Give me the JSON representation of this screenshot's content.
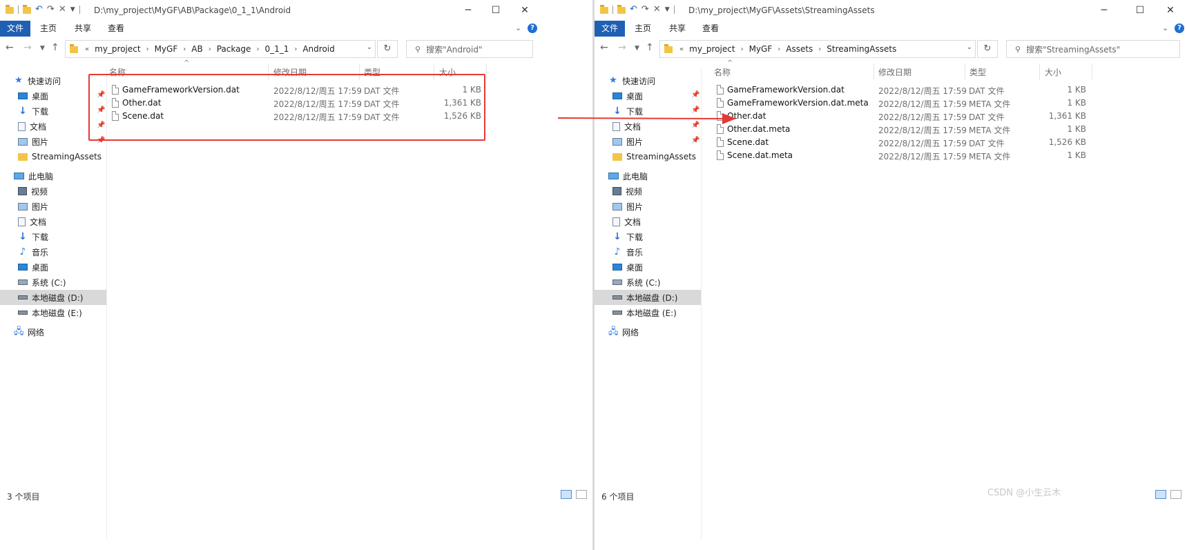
{
  "left": {
    "title_path": "D:\\my_project\\MyGF\\AB\\Package\\0_1_1\\Android",
    "ribbon": {
      "file": "文件",
      "home": "主页",
      "share": "共享",
      "view": "查看"
    },
    "breadcrumb": [
      "my_project",
      "MyGF",
      "AB",
      "Package",
      "0_1_1",
      "Android"
    ],
    "search_placeholder": "搜索\"Android\"",
    "columns": {
      "name": "名称",
      "date": "修改日期",
      "type": "类型",
      "size": "大小"
    },
    "files": [
      {
        "name": "GameFrameworkVersion.dat",
        "date": "2022/8/12/周五 17:59",
        "type": "DAT 文件",
        "size": "1 KB"
      },
      {
        "name": "Other.dat",
        "date": "2022/8/12/周五 17:59",
        "type": "DAT 文件",
        "size": "1,361 KB"
      },
      {
        "name": "Scene.dat",
        "date": "2022/8/12/周五 17:59",
        "type": "DAT 文件",
        "size": "1,526 KB"
      }
    ],
    "status": "3 个项目"
  },
  "right": {
    "title_path": "D:\\my_project\\MyGF\\Assets\\StreamingAssets",
    "ribbon": {
      "file": "文件",
      "home": "主页",
      "share": "共享",
      "view": "查看"
    },
    "breadcrumb": [
      "my_project",
      "MyGF",
      "Assets",
      "StreamingAssets"
    ],
    "search_placeholder": "搜索\"StreamingAssets\"",
    "columns": {
      "name": "名称",
      "date": "修改日期",
      "type": "类型",
      "size": "大小"
    },
    "files": [
      {
        "name": "GameFrameworkVersion.dat",
        "date": "2022/8/12/周五 17:59",
        "type": "DAT 文件",
        "size": "1 KB"
      },
      {
        "name": "GameFrameworkVersion.dat.meta",
        "date": "2022/8/12/周五 17:59",
        "type": "META 文件",
        "size": "1 KB"
      },
      {
        "name": "Other.dat",
        "date": "2022/8/12/周五 17:59",
        "type": "DAT 文件",
        "size": "1,361 KB"
      },
      {
        "name": "Other.dat.meta",
        "date": "2022/8/12/周五 17:59",
        "type": "META 文件",
        "size": "1 KB"
      },
      {
        "name": "Scene.dat",
        "date": "2022/8/12/周五 17:59",
        "type": "DAT 文件",
        "size": "1,526 KB"
      },
      {
        "name": "Scene.dat.meta",
        "date": "2022/8/12/周五 17:59",
        "type": "META 文件",
        "size": "1 KB"
      }
    ],
    "status": "6 个项目"
  },
  "nav": {
    "quick_access": "快速访问",
    "desktop": "桌面",
    "downloads": "下载",
    "documents": "文档",
    "pictures": "图片",
    "streaming_assets": "StreamingAssets",
    "this_pc": "此电脑",
    "videos": "视频",
    "pictures2": "图片",
    "documents2": "文档",
    "downloads2": "下载",
    "music": "音乐",
    "desktop2": "桌面",
    "drive_c": "系统 (C:)",
    "drive_d": "本地磁盘 (D:)",
    "drive_e": "本地磁盘 (E:)",
    "network": "网络"
  },
  "watermark": "CSDN @小生云木",
  "colors": {
    "file_tab": "#1f5fb4",
    "annotation": "#e53935",
    "selected_nav": "#d9d9d9"
  }
}
